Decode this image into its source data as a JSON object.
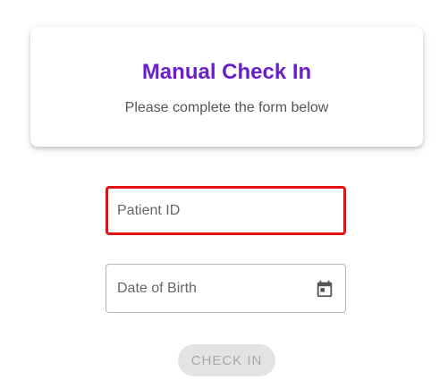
{
  "header": {
    "title": "Manual Check In",
    "subtitle": "Please complete the form below",
    "title_color": "#6a1fc9"
  },
  "form": {
    "patient_id": {
      "placeholder": "Patient ID",
      "value": "",
      "focused": true,
      "focus_color": "#e41313"
    },
    "date_of_birth": {
      "placeholder": "Date of Birth",
      "value": "",
      "icon": "calendar-icon"
    },
    "submit": {
      "label": "CHECK IN",
      "disabled": true
    }
  }
}
